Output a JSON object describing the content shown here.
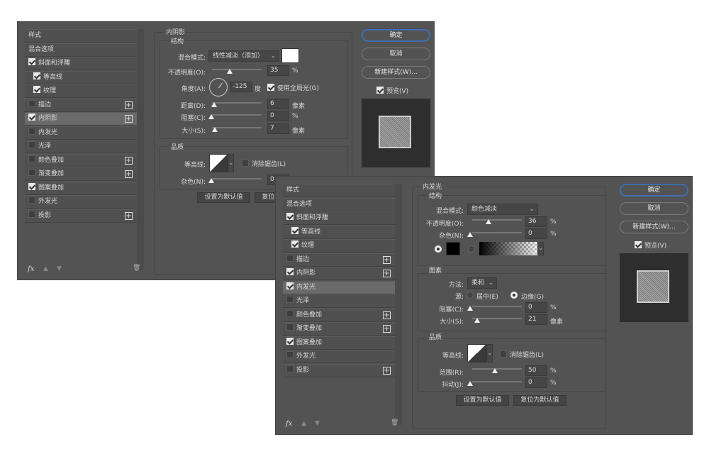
{
  "dialogs": [
    {
      "list_header": "样式",
      "blend_options": "混合选项",
      "items": [
        {
          "label": "斜面和浮雕",
          "checked": true,
          "indent": false,
          "plus": false,
          "selected": false
        },
        {
          "label": "等高线",
          "checked": true,
          "indent": true,
          "plus": false,
          "selected": false
        },
        {
          "label": "纹理",
          "checked": true,
          "indent": true,
          "plus": false,
          "selected": false
        },
        {
          "label": "描边",
          "checked": false,
          "indent": false,
          "plus": true,
          "selected": false
        },
        {
          "label": "内阴影",
          "checked": true,
          "indent": false,
          "plus": true,
          "selected": true
        },
        {
          "label": "内发光",
          "checked": false,
          "indent": false,
          "plus": false,
          "selected": false
        },
        {
          "label": "光泽",
          "checked": false,
          "indent": false,
          "plus": false,
          "selected": false
        },
        {
          "label": "颜色叠加",
          "checked": false,
          "indent": false,
          "plus": true,
          "selected": false
        },
        {
          "label": "渐变叠加",
          "checked": false,
          "indent": false,
          "plus": true,
          "selected": false
        },
        {
          "label": "图案叠加",
          "checked": true,
          "indent": false,
          "plus": false,
          "selected": false
        },
        {
          "label": "外发光",
          "checked": false,
          "indent": false,
          "plus": false,
          "selected": false
        },
        {
          "label": "投影",
          "checked": false,
          "indent": false,
          "plus": true,
          "selected": false
        }
      ],
      "footer": {
        "fx": "fx",
        "up_icon": "arrow-up-icon",
        "down_icon": "arrow-down-icon",
        "trash_icon": "trash-icon"
      },
      "buttons": {
        "ok": "确定",
        "cancel": "取消",
        "new_style": "新建样式(W)...",
        "preview": "预览(V)",
        "preview_checked": true
      },
      "panel": {
        "title": "内阴影",
        "structure": "结构",
        "blend_mode_label": "混合模式:",
        "blend_mode": "线性减淡（添加）",
        "color": "#ffffff",
        "opacity_label": "不透明度(O):",
        "opacity": "35",
        "opacity_unit": "%",
        "angle_label": "角度(A):",
        "angle": "-125",
        "angle_unit": "度",
        "global_light": "使用全局光(G)",
        "global_light_checked": true,
        "distance_label": "距离(D):",
        "distance": "6",
        "distance_unit": "像素",
        "choke_label": "阻塞(C):",
        "choke": "0",
        "choke_unit": "%",
        "size_label": "大小(S):",
        "size": "7",
        "size_unit": "像素",
        "quality": "品质",
        "contour_label": "等高线:",
        "anti_alias": "消除锯齿(L)",
        "anti_alias_checked": false,
        "noise_label": "杂色(N):",
        "noise": "0",
        "make_default": "设置为默认值",
        "reset_default": "复位为默认值"
      }
    },
    {
      "list_header": "样式",
      "blend_options": "混合选项",
      "items": [
        {
          "label": "斜面和浮雕",
          "checked": true,
          "indent": false,
          "plus": false,
          "selected": false
        },
        {
          "label": "等高线",
          "checked": true,
          "indent": true,
          "plus": false,
          "selected": false
        },
        {
          "label": "纹理",
          "checked": true,
          "indent": true,
          "plus": false,
          "selected": false
        },
        {
          "label": "描边",
          "checked": false,
          "indent": false,
          "plus": true,
          "selected": false
        },
        {
          "label": "内阴影",
          "checked": true,
          "indent": false,
          "plus": true,
          "selected": false
        },
        {
          "label": "内发光",
          "checked": true,
          "indent": false,
          "plus": false,
          "selected": true
        },
        {
          "label": "光泽",
          "checked": false,
          "indent": false,
          "plus": false,
          "selected": false
        },
        {
          "label": "颜色叠加",
          "checked": false,
          "indent": false,
          "plus": true,
          "selected": false
        },
        {
          "label": "渐变叠加",
          "checked": false,
          "indent": false,
          "plus": true,
          "selected": false
        },
        {
          "label": "图案叠加",
          "checked": true,
          "indent": false,
          "plus": false,
          "selected": false
        },
        {
          "label": "外发光",
          "checked": false,
          "indent": false,
          "plus": false,
          "selected": false
        },
        {
          "label": "投影",
          "checked": false,
          "indent": false,
          "plus": true,
          "selected": false
        }
      ],
      "footer": {
        "fx": "fx",
        "up_icon": "arrow-up-icon",
        "down_icon": "arrow-down-icon",
        "trash_icon": "trash-icon"
      },
      "buttons": {
        "ok": "确定",
        "cancel": "取消",
        "new_style": "新建样式(W)...",
        "preview": "预览(V)",
        "preview_checked": true
      },
      "panel": {
        "title": "内发光",
        "structure": "结构",
        "blend_mode_label": "混合模式:",
        "blend_mode": "颜色减淡",
        "opacity_label": "不透明度(O):",
        "opacity": "36",
        "opacity_unit": "%",
        "noise_label": "杂色(N):",
        "noise": "0",
        "noise_unit": "%",
        "color": "#000000",
        "fill_type": "color",
        "elements": "图素",
        "technique_label": "方法:",
        "technique": "柔和",
        "source_label": "源:",
        "source_center": "居中(E)",
        "source_edge": "边缘(G)",
        "source_selected": "edge",
        "choke_label": "阻塞(C):",
        "choke": "0",
        "choke_unit": "%",
        "size_label": "大小(S):",
        "size": "21",
        "size_unit": "像素",
        "quality": "品质",
        "contour_label": "等高线:",
        "anti_alias": "消除锯齿(L)",
        "anti_alias_checked": false,
        "range_label": "范围(R):",
        "range": "50",
        "range_unit": "%",
        "jitter_label": "抖动(J):",
        "jitter": "0",
        "jitter_unit": "%",
        "make_default": "设置为默认值",
        "reset_default": "复位为默认值"
      }
    }
  ]
}
